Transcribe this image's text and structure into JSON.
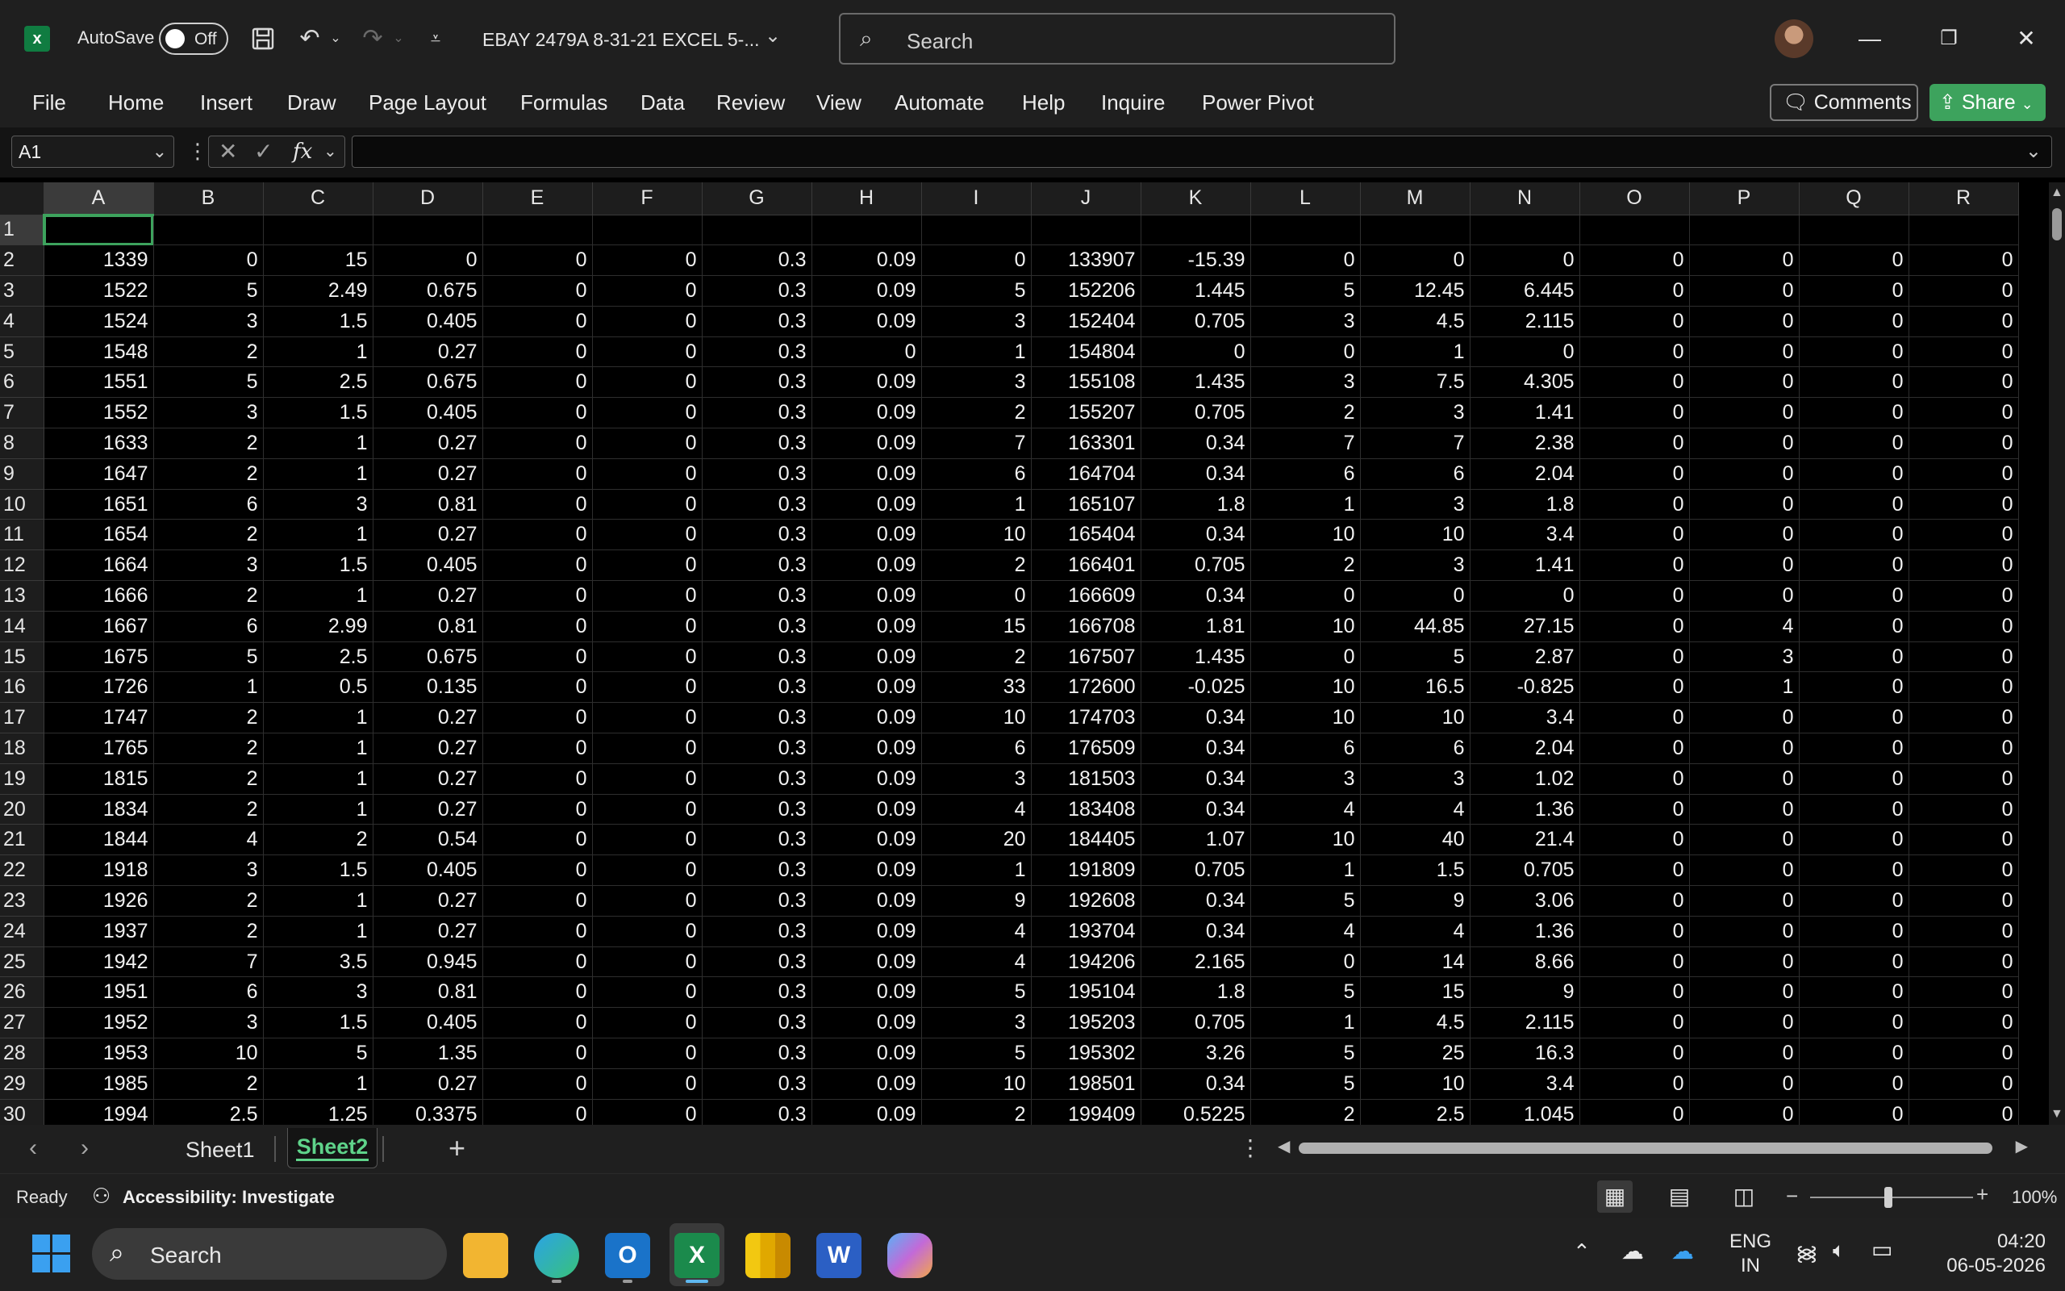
{
  "title_bar": {
    "autosave_label": "AutoSave",
    "autosave_state": "Off",
    "doc_title": "EBAY 2479A 8-31-21 EXCEL 5-...",
    "search_placeholder": "Search",
    "icons": [
      "excel-logo-icon",
      "save-icon",
      "undo-icon",
      "redo-icon",
      "customize-icon",
      "search-icon",
      "minimize-icon",
      "restore-icon",
      "close-icon"
    ]
  },
  "ribbon": {
    "tabs": [
      "File",
      "Home",
      "Insert",
      "Draw",
      "Page Layout",
      "Formulas",
      "Data",
      "Review",
      "View",
      "Automate",
      "Help",
      "Inquire",
      "Power Pivot"
    ],
    "comments_label": "Comments",
    "share_label": "Share"
  },
  "formula_bar": {
    "name_box": "A1",
    "formula": "",
    "fx_label": "fx"
  },
  "grid": {
    "columns": [
      "A",
      "B",
      "C",
      "D",
      "E",
      "F",
      "G",
      "H",
      "I",
      "J",
      "K",
      "L",
      "M",
      "N",
      "O",
      "P",
      "Q",
      "R"
    ],
    "rows": [
      {
        "n": "1",
        "cells": [
          "",
          "",
          "",
          "",
          "",
          "",
          "",
          "",
          "",
          "",
          "",
          "",
          "",
          "",
          "",
          "",
          "",
          ""
        ]
      },
      {
        "n": "2",
        "cells": [
          "1339",
          "0",
          "15",
          "0",
          "0",
          "0",
          "0.3",
          "0.09",
          "0",
          "133907",
          "-15.39",
          "0",
          "0",
          "0",
          "0",
          "0",
          "0",
          "0"
        ]
      },
      {
        "n": "3",
        "cells": [
          "1522",
          "5",
          "2.49",
          "0.675",
          "0",
          "0",
          "0.3",
          "0.09",
          "5",
          "152206",
          "1.445",
          "5",
          "12.45",
          "6.445",
          "0",
          "0",
          "0",
          "0"
        ]
      },
      {
        "n": "4",
        "cells": [
          "1524",
          "3",
          "1.5",
          "0.405",
          "0",
          "0",
          "0.3",
          "0.09",
          "3",
          "152404",
          "0.705",
          "3",
          "4.5",
          "2.115",
          "0",
          "0",
          "0",
          "0"
        ]
      },
      {
        "n": "5",
        "cells": [
          "1548",
          "2",
          "1",
          "0.27",
          "0",
          "0",
          "0.3",
          "0",
          "1",
          "154804",
          "0",
          "0",
          "1",
          "0",
          "0",
          "0",
          "0",
          "0"
        ]
      },
      {
        "n": "6",
        "cells": [
          "1551",
          "5",
          "2.5",
          "0.675",
          "0",
          "0",
          "0.3",
          "0.09",
          "3",
          "155108",
          "1.435",
          "3",
          "7.5",
          "4.305",
          "0",
          "0",
          "0",
          "0"
        ]
      },
      {
        "n": "7",
        "cells": [
          "1552",
          "3",
          "1.5",
          "0.405",
          "0",
          "0",
          "0.3",
          "0.09",
          "2",
          "155207",
          "0.705",
          "2",
          "3",
          "1.41",
          "0",
          "0",
          "0",
          "0"
        ]
      },
      {
        "n": "8",
        "cells": [
          "1633",
          "2",
          "1",
          "0.27",
          "0",
          "0",
          "0.3",
          "0.09",
          "7",
          "163301",
          "0.34",
          "7",
          "7",
          "2.38",
          "0",
          "0",
          "0",
          "0"
        ]
      },
      {
        "n": "9",
        "cells": [
          "1647",
          "2",
          "1",
          "0.27",
          "0",
          "0",
          "0.3",
          "0.09",
          "6",
          "164704",
          "0.34",
          "6",
          "6",
          "2.04",
          "0",
          "0",
          "0",
          "0"
        ]
      },
      {
        "n": "10",
        "cells": [
          "1651",
          "6",
          "3",
          "0.81",
          "0",
          "0",
          "0.3",
          "0.09",
          "1",
          "165107",
          "1.8",
          "1",
          "3",
          "1.8",
          "0",
          "0",
          "0",
          "0"
        ]
      },
      {
        "n": "11",
        "cells": [
          "1654",
          "2",
          "1",
          "0.27",
          "0",
          "0",
          "0.3",
          "0.09",
          "10",
          "165404",
          "0.34",
          "10",
          "10",
          "3.4",
          "0",
          "0",
          "0",
          "0"
        ]
      },
      {
        "n": "12",
        "cells": [
          "1664",
          "3",
          "1.5",
          "0.405",
          "0",
          "0",
          "0.3",
          "0.09",
          "2",
          "166401",
          "0.705",
          "2",
          "3",
          "1.41",
          "0",
          "0",
          "0",
          "0"
        ]
      },
      {
        "n": "13",
        "cells": [
          "1666",
          "2",
          "1",
          "0.27",
          "0",
          "0",
          "0.3",
          "0.09",
          "0",
          "166609",
          "0.34",
          "0",
          "0",
          "0",
          "0",
          "0",
          "0",
          "0"
        ]
      },
      {
        "n": "14",
        "cells": [
          "1667",
          "6",
          "2.99",
          "0.81",
          "0",
          "0",
          "0.3",
          "0.09",
          "15",
          "166708",
          "1.81",
          "10",
          "44.85",
          "27.15",
          "0",
          "4",
          "0",
          "0"
        ]
      },
      {
        "n": "15",
        "cells": [
          "1675",
          "5",
          "2.5",
          "0.675",
          "0",
          "0",
          "0.3",
          "0.09",
          "2",
          "167507",
          "1.435",
          "0",
          "5",
          "2.87",
          "0",
          "3",
          "0",
          "0"
        ]
      },
      {
        "n": "16",
        "cells": [
          "1726",
          "1",
          "0.5",
          "0.135",
          "0",
          "0",
          "0.3",
          "0.09",
          "33",
          "172600",
          "-0.025",
          "10",
          "16.5",
          "-0.825",
          "0",
          "1",
          "0",
          "0"
        ]
      },
      {
        "n": "17",
        "cells": [
          "1747",
          "2",
          "1",
          "0.27",
          "0",
          "0",
          "0.3",
          "0.09",
          "10",
          "174703",
          "0.34",
          "10",
          "10",
          "3.4",
          "0",
          "0",
          "0",
          "0"
        ]
      },
      {
        "n": "18",
        "cells": [
          "1765",
          "2",
          "1",
          "0.27",
          "0",
          "0",
          "0.3",
          "0.09",
          "6",
          "176509",
          "0.34",
          "6",
          "6",
          "2.04",
          "0",
          "0",
          "0",
          "0"
        ]
      },
      {
        "n": "19",
        "cells": [
          "1815",
          "2",
          "1",
          "0.27",
          "0",
          "0",
          "0.3",
          "0.09",
          "3",
          "181503",
          "0.34",
          "3",
          "3",
          "1.02",
          "0",
          "0",
          "0",
          "0"
        ]
      },
      {
        "n": "20",
        "cells": [
          "1834",
          "2",
          "1",
          "0.27",
          "0",
          "0",
          "0.3",
          "0.09",
          "4",
          "183408",
          "0.34",
          "4",
          "4",
          "1.36",
          "0",
          "0",
          "0",
          "0"
        ]
      },
      {
        "n": "21",
        "cells": [
          "1844",
          "4",
          "2",
          "0.54",
          "0",
          "0",
          "0.3",
          "0.09",
          "20",
          "184405",
          "1.07",
          "10",
          "40",
          "21.4",
          "0",
          "0",
          "0",
          "0"
        ]
      },
      {
        "n": "22",
        "cells": [
          "1918",
          "3",
          "1.5",
          "0.405",
          "0",
          "0",
          "0.3",
          "0.09",
          "1",
          "191809",
          "0.705",
          "1",
          "1.5",
          "0.705",
          "0",
          "0",
          "0",
          "0"
        ]
      },
      {
        "n": "23",
        "cells": [
          "1926",
          "2",
          "1",
          "0.27",
          "0",
          "0",
          "0.3",
          "0.09",
          "9",
          "192608",
          "0.34",
          "5",
          "9",
          "3.06",
          "0",
          "0",
          "0",
          "0"
        ]
      },
      {
        "n": "24",
        "cells": [
          "1937",
          "2",
          "1",
          "0.27",
          "0",
          "0",
          "0.3",
          "0.09",
          "4",
          "193704",
          "0.34",
          "4",
          "4",
          "1.36",
          "0",
          "0",
          "0",
          "0"
        ]
      },
      {
        "n": "25",
        "cells": [
          "1942",
          "7",
          "3.5",
          "0.945",
          "0",
          "0",
          "0.3",
          "0.09",
          "4",
          "194206",
          "2.165",
          "0",
          "14",
          "8.66",
          "0",
          "0",
          "0",
          "0"
        ]
      },
      {
        "n": "26",
        "cells": [
          "1951",
          "6",
          "3",
          "0.81",
          "0",
          "0",
          "0.3",
          "0.09",
          "5",
          "195104",
          "1.8",
          "5",
          "15",
          "9",
          "0",
          "0",
          "0",
          "0"
        ]
      },
      {
        "n": "27",
        "cells": [
          "1952",
          "3",
          "1.5",
          "0.405",
          "0",
          "0",
          "0.3",
          "0.09",
          "3",
          "195203",
          "0.705",
          "1",
          "4.5",
          "2.115",
          "0",
          "0",
          "0",
          "0"
        ]
      },
      {
        "n": "28",
        "cells": [
          "1953",
          "10",
          "5",
          "1.35",
          "0",
          "0",
          "0.3",
          "0.09",
          "5",
          "195302",
          "3.26",
          "5",
          "25",
          "16.3",
          "0",
          "0",
          "0",
          "0"
        ]
      },
      {
        "n": "29",
        "cells": [
          "1985",
          "2",
          "1",
          "0.27",
          "0",
          "0",
          "0.3",
          "0.09",
          "10",
          "198501",
          "0.34",
          "5",
          "10",
          "3.4",
          "0",
          "0",
          "0",
          "0"
        ]
      },
      {
        "n": "30",
        "cells": [
          "1994",
          "2.5",
          "1.25",
          "0.3375",
          "0",
          "0",
          "0.3",
          "0.09",
          "2",
          "199409",
          "0.5225",
          "2",
          "2.5",
          "1.045",
          "0",
          "0",
          "0",
          "0"
        ]
      }
    ]
  },
  "sheet_tabs": {
    "tabs": [
      "Sheet1",
      "Sheet2"
    ],
    "active": "Sheet2",
    "add_label": "+"
  },
  "status_bar": {
    "ready": "Ready",
    "accessibility": "Accessibility: Investigate",
    "zoom": "100%"
  },
  "taskbar": {
    "search_placeholder": "Search",
    "apps": [
      "file-explorer-icon",
      "edge-icon",
      "outlook-icon",
      "excel-icon",
      "power-bi-icon",
      "word-icon",
      "copilot-icon"
    ],
    "language_line1": "ENG",
    "language_line2": "IN",
    "time": "04:20",
    "date": "06-05-2026"
  },
  "colors": {
    "accent_green": "#3da35d",
    "background": "#000000",
    "chrome": "#1f1f1f"
  }
}
